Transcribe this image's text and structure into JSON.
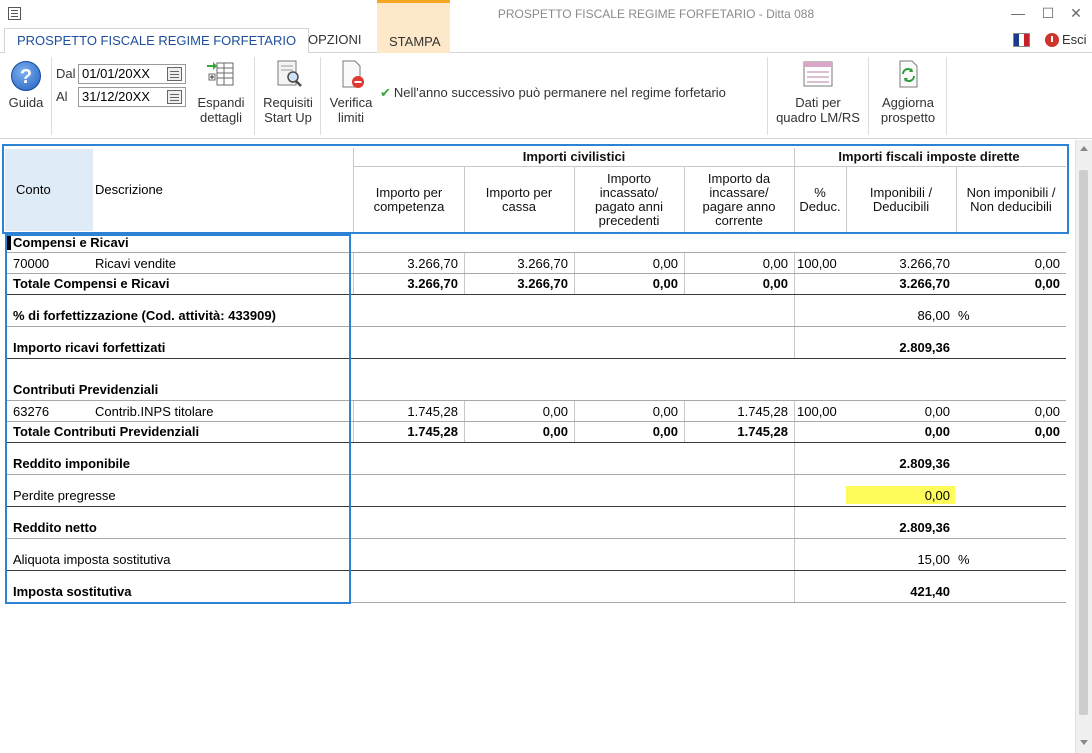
{
  "window": {
    "title": "PROSPETTO FISCALE REGIME FORFETARIO - Ditta 088",
    "minimize": "—",
    "maximize": "☐",
    "close": "✕"
  },
  "tabs": [
    {
      "label": "PROSPETTO FISCALE REGIME FORFETARIO"
    },
    {
      "label": "OPZIONI"
    },
    {
      "label": "STAMPA"
    }
  ],
  "exit_label": "Esci",
  "toolbar": {
    "help_label": "Guida",
    "help_glyph": "?",
    "from_label": "Dal",
    "from_value": "01/01/20XX",
    "to_label": "Al",
    "to_value": "31/12/20XX",
    "expand_label_1": "Espandi",
    "expand_label_2": "dettagli",
    "requisiti_label_1": "Requisiti",
    "requisiti_label_2": "Start Up",
    "verifica_label_1": "Verifica",
    "verifica_label_2": "limiti",
    "message": "Nell'anno successivo può permanere nel regime forfetario",
    "dati_label_1": "Dati per",
    "dati_label_2": "quadro LM/RS",
    "aggiorna_label_1": "Aggiorna",
    "aggiorna_label_2": "prospetto"
  },
  "table_header": {
    "conto": "Conto",
    "descrizione": "Descrizione",
    "group_civ": "Importi civilistici",
    "group_fisc": "Importi fiscali imposte dirette",
    "col1": [
      "Importo per",
      "competenza"
    ],
    "col2": [
      "Importo per",
      "cassa"
    ],
    "col3": [
      "Importo",
      "incassato/",
      "pagato anni",
      "precedenti"
    ],
    "col4": [
      "Importo da",
      "incassare/",
      "pagare anno",
      "corrente"
    ],
    "col5": [
      "%",
      "Deduc."
    ],
    "col6": [
      "Imponibili /",
      "Deducibili"
    ],
    "col7": [
      "Non imponibili /",
      "Non deducibili"
    ]
  },
  "rows": {
    "sec1": "Compensi e Ricavi",
    "r1": {
      "conto": "70000",
      "desc": "Ricavi vendite",
      "c1": "3.266,70",
      "c2": "3.266,70",
      "c3": "0,00",
      "c4": "0,00",
      "c5": "100,00",
      "c6": "3.266,70",
      "c7": "0,00"
    },
    "t1": {
      "label": "Totale Compensi e Ricavi",
      "c1": "3.266,70",
      "c2": "3.266,70",
      "c3": "0,00",
      "c4": "0,00",
      "c6": "3.266,70",
      "c7": "0,00"
    },
    "forf": {
      "label": "% di forfettizzazione (Cod. attività: 433909)",
      "value": "86,00",
      "unit": "%"
    },
    "ricavi_forf": {
      "label": "Importo ricavi forfettizati",
      "value": "2.809,36"
    },
    "sec2": "Contributi Previdenziali",
    "r2": {
      "conto": "63276",
      "desc": "Contrib.INPS titolare",
      "c1": "1.745,28",
      "c2": "0,00",
      "c3": "0,00",
      "c4": "1.745,28",
      "c5": "100,00",
      "c6": "0,00",
      "c7": "0,00"
    },
    "t2": {
      "label": "Totale Contributi Previdenziali",
      "c1": "1.745,28",
      "c2": "0,00",
      "c3": "0,00",
      "c4": "1.745,28",
      "c6": "0,00",
      "c7": "0,00"
    },
    "reddito_imp": {
      "label": "Reddito imponibile",
      "value": "2.809,36"
    },
    "perdite": {
      "label": "Perdite pregresse",
      "value": "0,00"
    },
    "reddito_netto": {
      "label": "Reddito netto",
      "value": "2.809,36"
    },
    "aliquota": {
      "label": "Aliquota imposta sostitutiva",
      "value": "15,00",
      "unit": "%"
    },
    "imposta": {
      "label": "Imposta sostitutiva",
      "value": "421,40"
    }
  },
  "colors": {
    "highlight_box": "#2c83d6",
    "editable_cell": "#fdfc5a",
    "active_tab_text": "#1e4e9c",
    "stampa_tab": "#fde9c9"
  }
}
